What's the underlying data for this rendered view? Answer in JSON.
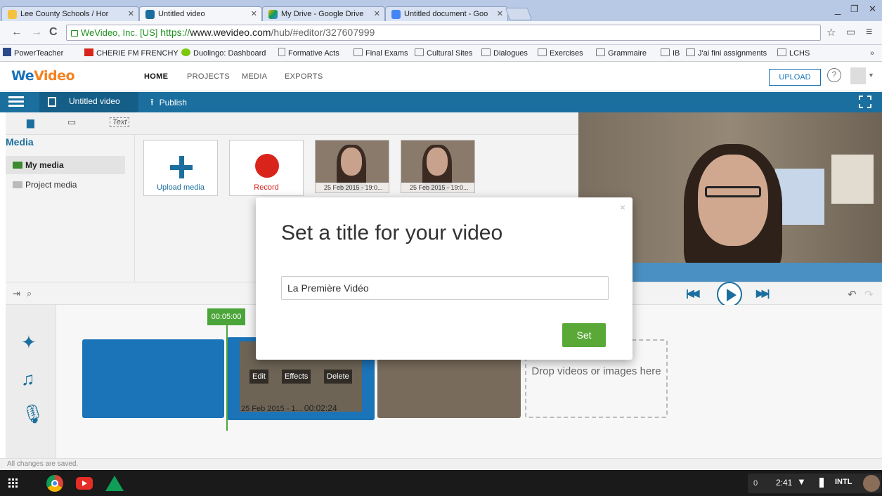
{
  "browser": {
    "tabs": [
      {
        "title": "Lee County Schools / Hor",
        "active": false
      },
      {
        "title": "Untitled video",
        "active": true
      },
      {
        "title": "My Drive - Google Drive",
        "active": false
      },
      {
        "title": "Untitled document - Goo",
        "active": false
      }
    ],
    "window_controls": {
      "minimize": "_",
      "restore": "❐",
      "close": "✕"
    },
    "omnibox": {
      "security_label": "WeVideo, Inc. [US]",
      "url_scheme": "https://",
      "url_host": "www.wevideo.com",
      "url_path": "/hub/#editor/327607999"
    },
    "bookmarks": [
      {
        "label": "PowerTeacher",
        "icon": "page-icon"
      },
      {
        "label": "CHERIE FM FRENCHY",
        "icon": "cherie-icon"
      },
      {
        "label": "Duolingo: Dashboard",
        "icon": "duolingo-icon"
      },
      {
        "label": "Formative Acts",
        "icon": "page-icon"
      },
      {
        "label": "Final Exams",
        "icon": "folder-icon"
      },
      {
        "label": "Cultural Sites",
        "icon": "folder-icon"
      },
      {
        "label": "Dialogues",
        "icon": "folder-icon"
      },
      {
        "label": "Exercises",
        "icon": "folder-icon"
      },
      {
        "label": "Grammaire",
        "icon": "folder-icon"
      },
      {
        "label": "IB",
        "icon": "folder-icon"
      },
      {
        "label": "J'ai fini assignments",
        "icon": "folder-icon"
      },
      {
        "label": "LCHS",
        "icon": "folder-icon"
      }
    ],
    "bookmarks_overflow": "»"
  },
  "app": {
    "logo_part1": "We",
    "logo_part2": "Video",
    "nav": [
      "HOME",
      "PROJECTS",
      "MEDIA",
      "EXPORTS"
    ],
    "upload_label": "UPLOAD",
    "help_label": "?"
  },
  "editor": {
    "project_title": "Untitled video",
    "publish_label": "Publish",
    "media_tab_text": "Text",
    "media_heading": "Media",
    "media_sources": [
      {
        "label": "My media",
        "selected": true
      },
      {
        "label": "Project media",
        "selected": false
      }
    ],
    "media_cards": [
      {
        "label": "Upload media"
      },
      {
        "label": "Record"
      }
    ],
    "media_thumbs": [
      "25 Feb 2015 - 19:0...",
      "25 Feb 2015 - 19:0..."
    ]
  },
  "timeline": {
    "playhead_time": "00:05:00",
    "clip_buttons": [
      "Edit",
      "Effects",
      "Delete"
    ],
    "selected_clip_label": "25 Feb 2015 - 1...",
    "selected_clip_duration": "00:02:24",
    "drop_zone_text": "Drop videos or images here",
    "status_text": "All changes are saved."
  },
  "modal": {
    "title": "Set a title for your video",
    "input_value": "La Première Vidéo",
    "set_button": "Set",
    "close_glyph": "×"
  },
  "shelf": {
    "notification_count": "0",
    "time": "2:41",
    "ime": "INTL"
  },
  "colors": {
    "brand_blue": "#1b6f9e",
    "record_red": "#d9241c",
    "set_green": "#59a838",
    "playhead_green": "#4ca53a"
  }
}
